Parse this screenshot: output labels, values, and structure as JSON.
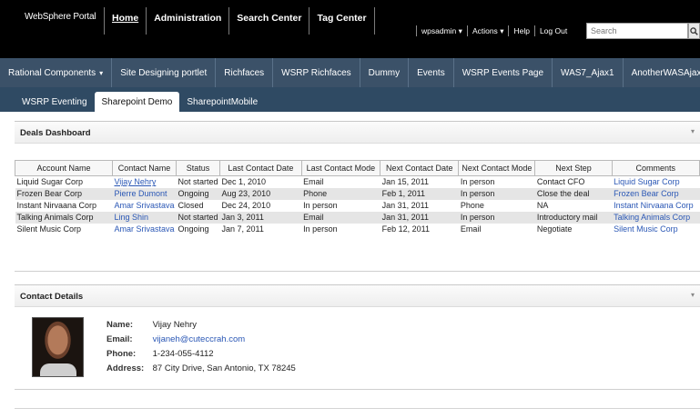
{
  "brand": "WebSphere Portal",
  "top_nav": [
    {
      "label": "Home",
      "selected": true
    },
    {
      "label": "Administration",
      "selected": false
    },
    {
      "label": "Search Center",
      "selected": false
    },
    {
      "label": "Tag Center",
      "selected": false
    }
  ],
  "utility": {
    "user": "wpsadmin",
    "actions": "Actions",
    "help": "Help",
    "logout": "Log Out",
    "search_placeholder": "Search",
    "search_icon": "search-icon"
  },
  "nav2": [
    {
      "label": "Rational Components",
      "has_menu": true
    },
    {
      "label": "Site Designing portlet",
      "has_menu": false
    },
    {
      "label": "Richfaces",
      "has_menu": false
    },
    {
      "label": "WSRP Richfaces",
      "has_menu": false
    },
    {
      "label": "Dummy",
      "has_menu": false
    },
    {
      "label": "Events",
      "has_menu": false
    },
    {
      "label": "WSRP Events Page",
      "has_menu": false
    },
    {
      "label": "WAS7_Ajax1",
      "has_menu": false
    },
    {
      "label": "AnotherWASAjax",
      "has_menu": false
    }
  ],
  "nav3": [
    {
      "label": "WSRP Eventing",
      "selected": false
    },
    {
      "label": "Sharepoint Demo",
      "selected": true
    },
    {
      "label": "SharepointMobile",
      "selected": false
    }
  ],
  "deals": {
    "title": "Deals Dashboard",
    "menu_icon": "portlet-menu-icon",
    "columns": [
      "Account Name",
      "Contact Name",
      "Status",
      "Last Contact Date",
      "Last Contact Mode",
      "Next Contact Date",
      "Next Contact Mode",
      "Next Step",
      "Comments"
    ],
    "rows": [
      [
        "Liquid Sugar Corp",
        "Vijay Nehry",
        "Not started",
        "Dec 1, 2010",
        "Email",
        "Jan 15, 2011",
        "In person",
        "Contact CFO",
        "Liquid Sugar Corp"
      ],
      [
        "Frozen Bear Corp",
        "Pierre Dumont",
        "Ongoing",
        "Aug 23, 2010",
        "Phone",
        "Feb 1, 2011",
        "In person",
        "Close the deal",
        "Frozen Bear Corp"
      ],
      [
        "Instant Nirvaana Corp",
        "Amar Srivastava",
        "Closed",
        "Dec 24, 2010",
        "In person",
        "Jan 31, 2011",
        "Phone",
        "NA",
        "Instant Nirvaana Corp"
      ],
      [
        "Talking Animals Corp",
        "Ling Shin",
        "Not started",
        "Jan 3, 2011",
        "Email",
        "Jan 31, 2011",
        "In person",
        "Introductory mail",
        "Talking Animals Corp"
      ],
      [
        "Silent Music Corp",
        "Amar Srivastava",
        "Ongoing",
        "Jan 7, 2011",
        "In person",
        "Feb 12, 2011",
        "Email",
        "Negotiate",
        "Silent Music Corp"
      ]
    ]
  },
  "contact": {
    "title": "Contact Details",
    "menu_icon": "portlet-menu-icon",
    "name_label": "Name:",
    "name": "Vijay Nehry",
    "email_label": "Email:",
    "email": "vijaneh@cuteccrah.com",
    "phone_label": "Phone:",
    "phone": "1-234-055-4112",
    "address_label": "Address:",
    "address": "87 City Drive, San Antonio, TX 78245"
  }
}
